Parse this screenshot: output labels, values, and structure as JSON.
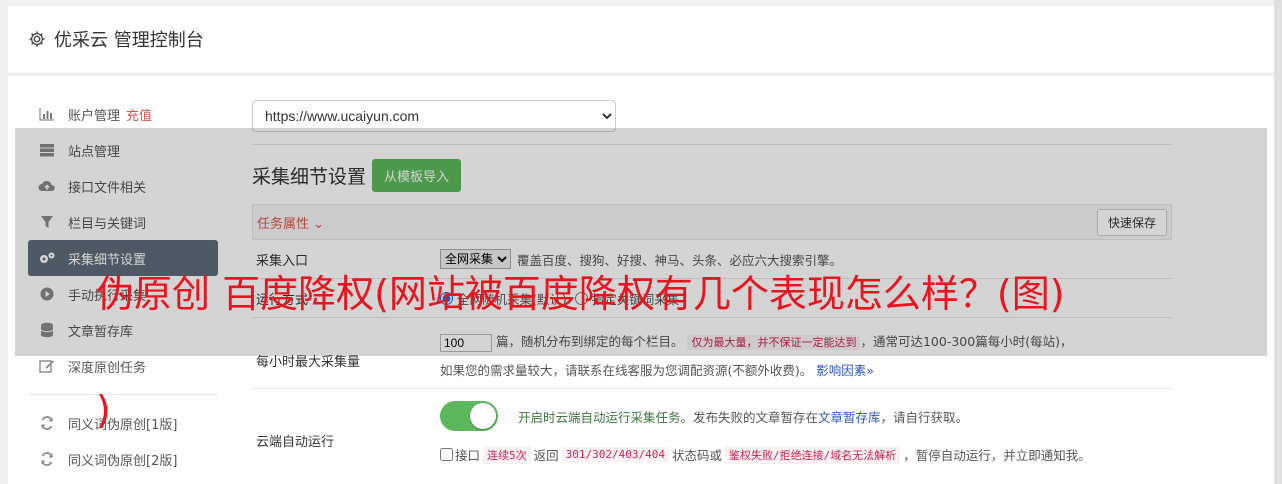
{
  "header": {
    "title": "优采云 管理控制台"
  },
  "sidebar": {
    "items": [
      {
        "label": "账户管理",
        "badge": "充值",
        "icon": "bar-chart-icon"
      },
      {
        "label": "站点管理",
        "icon": "server-icon"
      },
      {
        "label": "接口文件相关",
        "icon": "cloud-upload-icon"
      },
      {
        "label": "栏目与关键词",
        "icon": "filter-icon"
      },
      {
        "label": "采集细节设置",
        "icon": "gears-icon"
      },
      {
        "label": "手动执行采集",
        "icon": "play-icon"
      },
      {
        "label": "文章暂存库",
        "icon": "database-icon"
      },
      {
        "label": "深度原创任务",
        "icon": "edit-icon"
      },
      {
        "label": "同义词伪原创[1版]",
        "icon": "refresh-icon"
      },
      {
        "label": "同义词伪原创[2版]",
        "icon": "refresh-icon"
      }
    ]
  },
  "main": {
    "site_select": "https://www.ucaiyun.com",
    "section_title": "采集细节设置",
    "import_button": "从模板导入",
    "task_attr_label": "任务属性",
    "quick_save": "快速保存",
    "rows": {
      "entry": {
        "label": "采集入口",
        "select_value": "全网采集",
        "desc": "覆盖百度、搜狗、好搜、神马、头条、必应六大搜索引擎。"
      },
      "mode": {
        "label": "运行方式",
        "opt1": "全网随机采集(默认)",
        "opt2": "指定关键词采集"
      },
      "max": {
        "label": "每小时最大采集量",
        "value": "100",
        "text1": "篇，随机分布到绑定的每个栏目。",
        "code1": "仅为最大量，并不保证一定能达到",
        "text2": "，通常可达100-300篇每小时(每站)，",
        "text3": "如果您的需求量较大，请联系在线客服为您调配资源(不额外收费)。",
        "link": "影响因素"
      },
      "cloud": {
        "label": "云端自动运行",
        "green": "开启时云端自动运行采集任务。",
        "text1": "发布失败的文章暂存在",
        "link": "文章暂存库",
        "text2": "，请自行获取。",
        "p1": "接口",
        "c1": "连续5次",
        "p2": "返回",
        "c2": "301/302/403/404",
        "p3": "状态码或",
        "c3": "鉴权失败/拒绝连接/域名无法解析",
        "p4": "，暂停自动运行，并立即通知我。"
      }
    }
  },
  "watermark": {
    "line1": "伪原创 百度降权(网站被百度降权有几个表现怎么样？(图)",
    "line2": ")"
  },
  "colors": {
    "accent_green": "#5cb85c",
    "sidebar_active": "#5f6b7a",
    "danger": "#d9534f",
    "watermark": "#e8141e"
  }
}
